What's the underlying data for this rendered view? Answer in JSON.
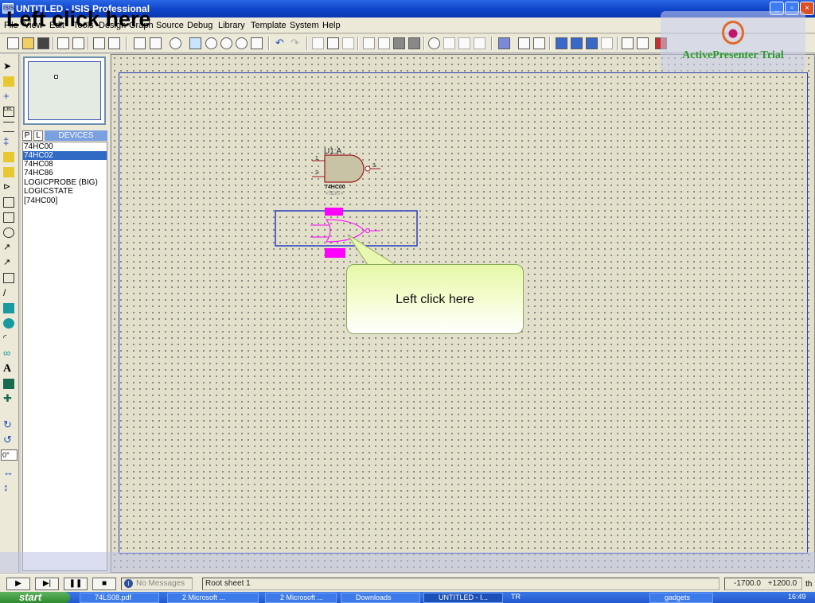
{
  "window": {
    "title": "UNTITLED - ISIS Professional",
    "icon_text": "ISIS"
  },
  "overlay_caption": "Left click here",
  "callout_text": "Left click here",
  "watermark": {
    "text": "ActivePresenter Trial"
  },
  "menu": {
    "items": [
      {
        "label": "File"
      },
      {
        "label": "View"
      },
      {
        "label": "Edit"
      },
      {
        "label": "Tools"
      },
      {
        "label": "Design"
      },
      {
        "label": "Graph"
      },
      {
        "label": "Source"
      },
      {
        "label": "Debug"
      },
      {
        "label": "Library"
      },
      {
        "label": "Template"
      },
      {
        "label": "System"
      },
      {
        "label": "Help"
      }
    ]
  },
  "devices_panel": {
    "tab_p": "P",
    "tab_l": "L",
    "header": "DEVICES",
    "items": [
      "74HC00",
      "74HC02",
      "74HC08",
      "74HC86",
      "LOGICPROBE (BIG)",
      "LOGICSTATE",
      "[74HC00]"
    ],
    "selected_index": 1
  },
  "rotation_value": "0°",
  "schematic": {
    "gate1": {
      "ref": "U1:A",
      "part": "74HC00",
      "text": "<TEXT>",
      "pin1": "1",
      "pin2": "2",
      "pin3": "3"
    }
  },
  "status": {
    "messages": "No Messages",
    "sheet": "Root sheet 1",
    "coord_x": "-1700.0",
    "coord_y": "+1200.0",
    "units": "th"
  },
  "taskbar": {
    "start": "start",
    "tasks": [
      "74LS08.pdf",
      "2 Microsoft ...",
      "2 Microsoft ...",
      "Downloads",
      "UNTITLED - I...",
      "gadgets"
    ],
    "lang": "TR",
    "clock": "16:49"
  },
  "colors": {
    "title_blue": "#1046cc",
    "selection_magenta": "#ff00ff",
    "gate_fill": "#c8c3a4",
    "gate_outline": "#9b1c1c"
  }
}
